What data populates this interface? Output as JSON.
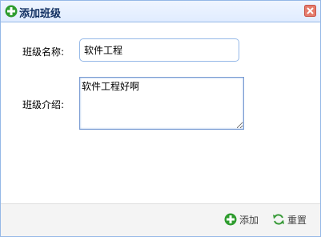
{
  "dialog": {
    "title": "添加班级",
    "title_icon": "add-icon",
    "close_icon": "close-icon"
  },
  "form": {
    "name_label": "班级名称:",
    "name_value": "软件工程",
    "desc_label": "班级介绍:",
    "desc_value": "软件工程好啊"
  },
  "footer": {
    "add_label": "添加",
    "add_icon": "add-icon",
    "reset_label": "重置",
    "reset_icon": "reload-icon"
  },
  "colors": {
    "border": "#95b8e7",
    "add_green": "#2e9c2e",
    "close_red": "#d9534f"
  }
}
